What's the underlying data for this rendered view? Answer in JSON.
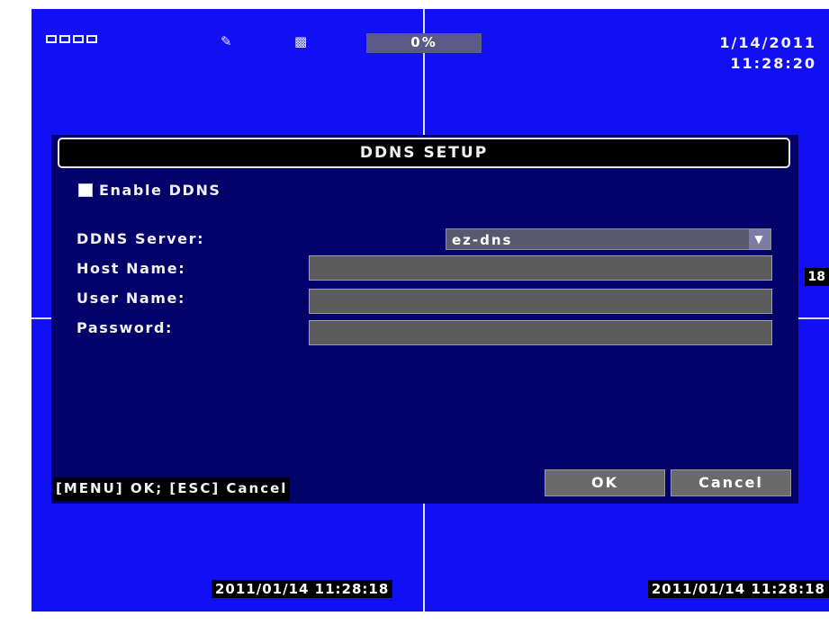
{
  "status_bar": {
    "channels": [
      "ch1",
      "ch2",
      "ch3",
      "ch4"
    ],
    "icons": [
      "record-status-icon",
      "network-status-icon"
    ],
    "progress": 0,
    "progress_text": "0%",
    "date": "1/14/2011",
    "time": "11:28:20"
  },
  "dialog": {
    "title": "DDNS SETUP",
    "enable_label": "Enable DDNS",
    "enable_checked": false,
    "server_label": "DDNS Server:",
    "server_value": "ez-dns",
    "host_label": "Host Name:",
    "host_value": "",
    "user_label": "User Name:",
    "user_value": "",
    "password_label": "Password:",
    "password_value": "",
    "hint": "[MENU] OK; [ESC] Cancel",
    "ok_label": "OK",
    "cancel_label": "Cancel"
  },
  "overlays": {
    "timestamp_left": "2011/01/14 11:28:18",
    "timestamp_right": "2011/01/14 11:28:18",
    "edge_tag": "18"
  },
  "colors": {
    "screen_bg": "#1010f2",
    "dialog_bg": "#02026a",
    "field_bg": "#5c5c5c"
  }
}
